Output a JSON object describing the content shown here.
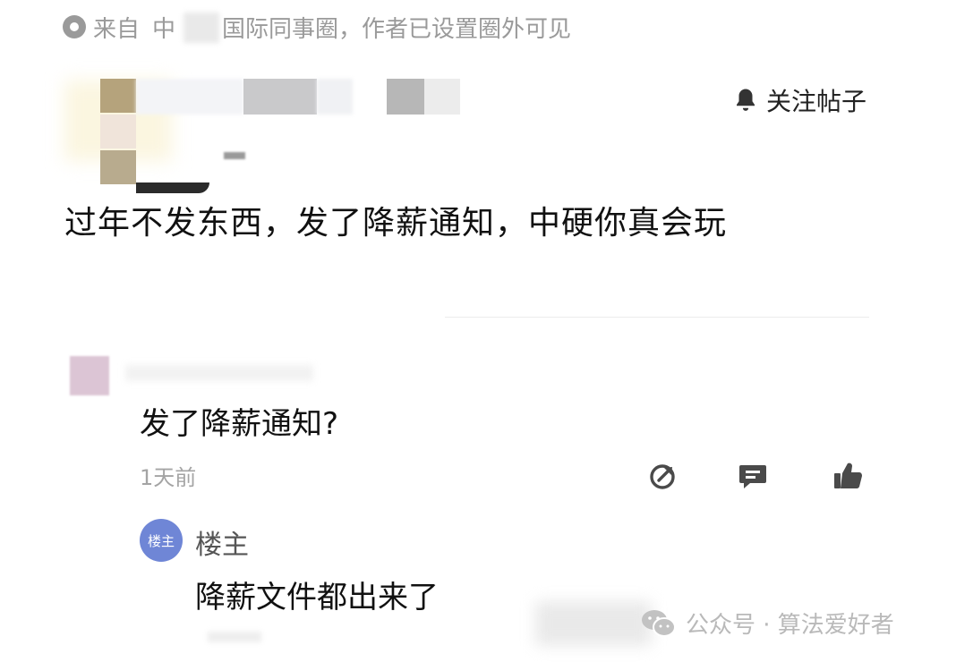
{
  "source": {
    "label_prefix": "来自",
    "group_prefix": "中",
    "group_suffix": "国际同事圈，作者已设置圈外可见"
  },
  "header": {
    "follow_label": "关注帖子"
  },
  "post": {
    "title": "过年不发东西，发了降薪通知，中硬你真会玩"
  },
  "comment": {
    "text": "发了降薪通知?",
    "time": "1天前"
  },
  "reply": {
    "badge": "楼主",
    "author_label": "楼主",
    "text": "降薪文件都出来了"
  },
  "watermark": {
    "text": "公众号 · 算法爱好者"
  },
  "icons": {
    "source": "circle-dot-icon",
    "follow": "bell-icon",
    "share": "share-icon",
    "reply": "comment-icon",
    "like": "thumbs-up-icon",
    "watermark": "wechat-icon"
  },
  "colors": {
    "muted": "#9a9a9a",
    "badge": "#6f86d6"
  }
}
